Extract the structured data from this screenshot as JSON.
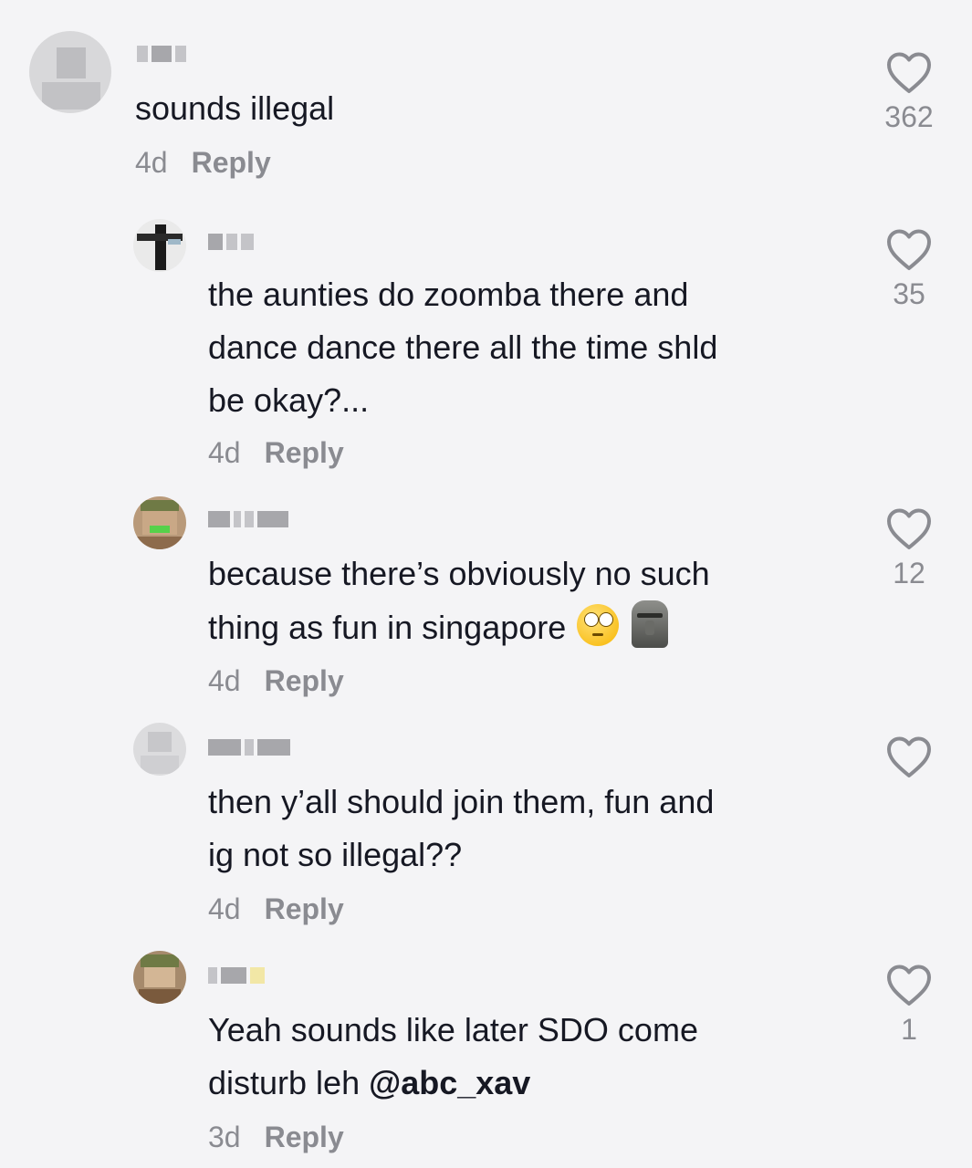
{
  "comments": [
    {
      "text": "sounds illegal",
      "age": "4d",
      "reply_label": "Reply",
      "likes": "362"
    },
    {
      "text": "the aunties do zoomba there and\ndance dance there all the time shld\nbe okay?...",
      "age": "4d",
      "reply_label": "Reply",
      "likes": "35"
    },
    {
      "text": "because there’s obviously no such\nthing as fun in singapore",
      "emojis": [
        "face-with-rolling-eyes-emoji",
        "moai-emoji"
      ],
      "age": "4d",
      "reply_label": "Reply",
      "likes": "12"
    },
    {
      "text": "then y’all should join them, fun and\nig not so illegal??",
      "age": "4d",
      "reply_label": "Reply",
      "likes": ""
    },
    {
      "text_prefix": "Yeah sounds like later SDO come\ndisturb leh ",
      "mention": "@abc_xav",
      "age": "3d",
      "reply_label": "Reply",
      "likes": "1"
    }
  ],
  "icons": {
    "like": "heart-outline-icon"
  },
  "colors": {
    "background": "#f4f4f6",
    "text": "#161823",
    "secondary": "#8a8b91"
  }
}
